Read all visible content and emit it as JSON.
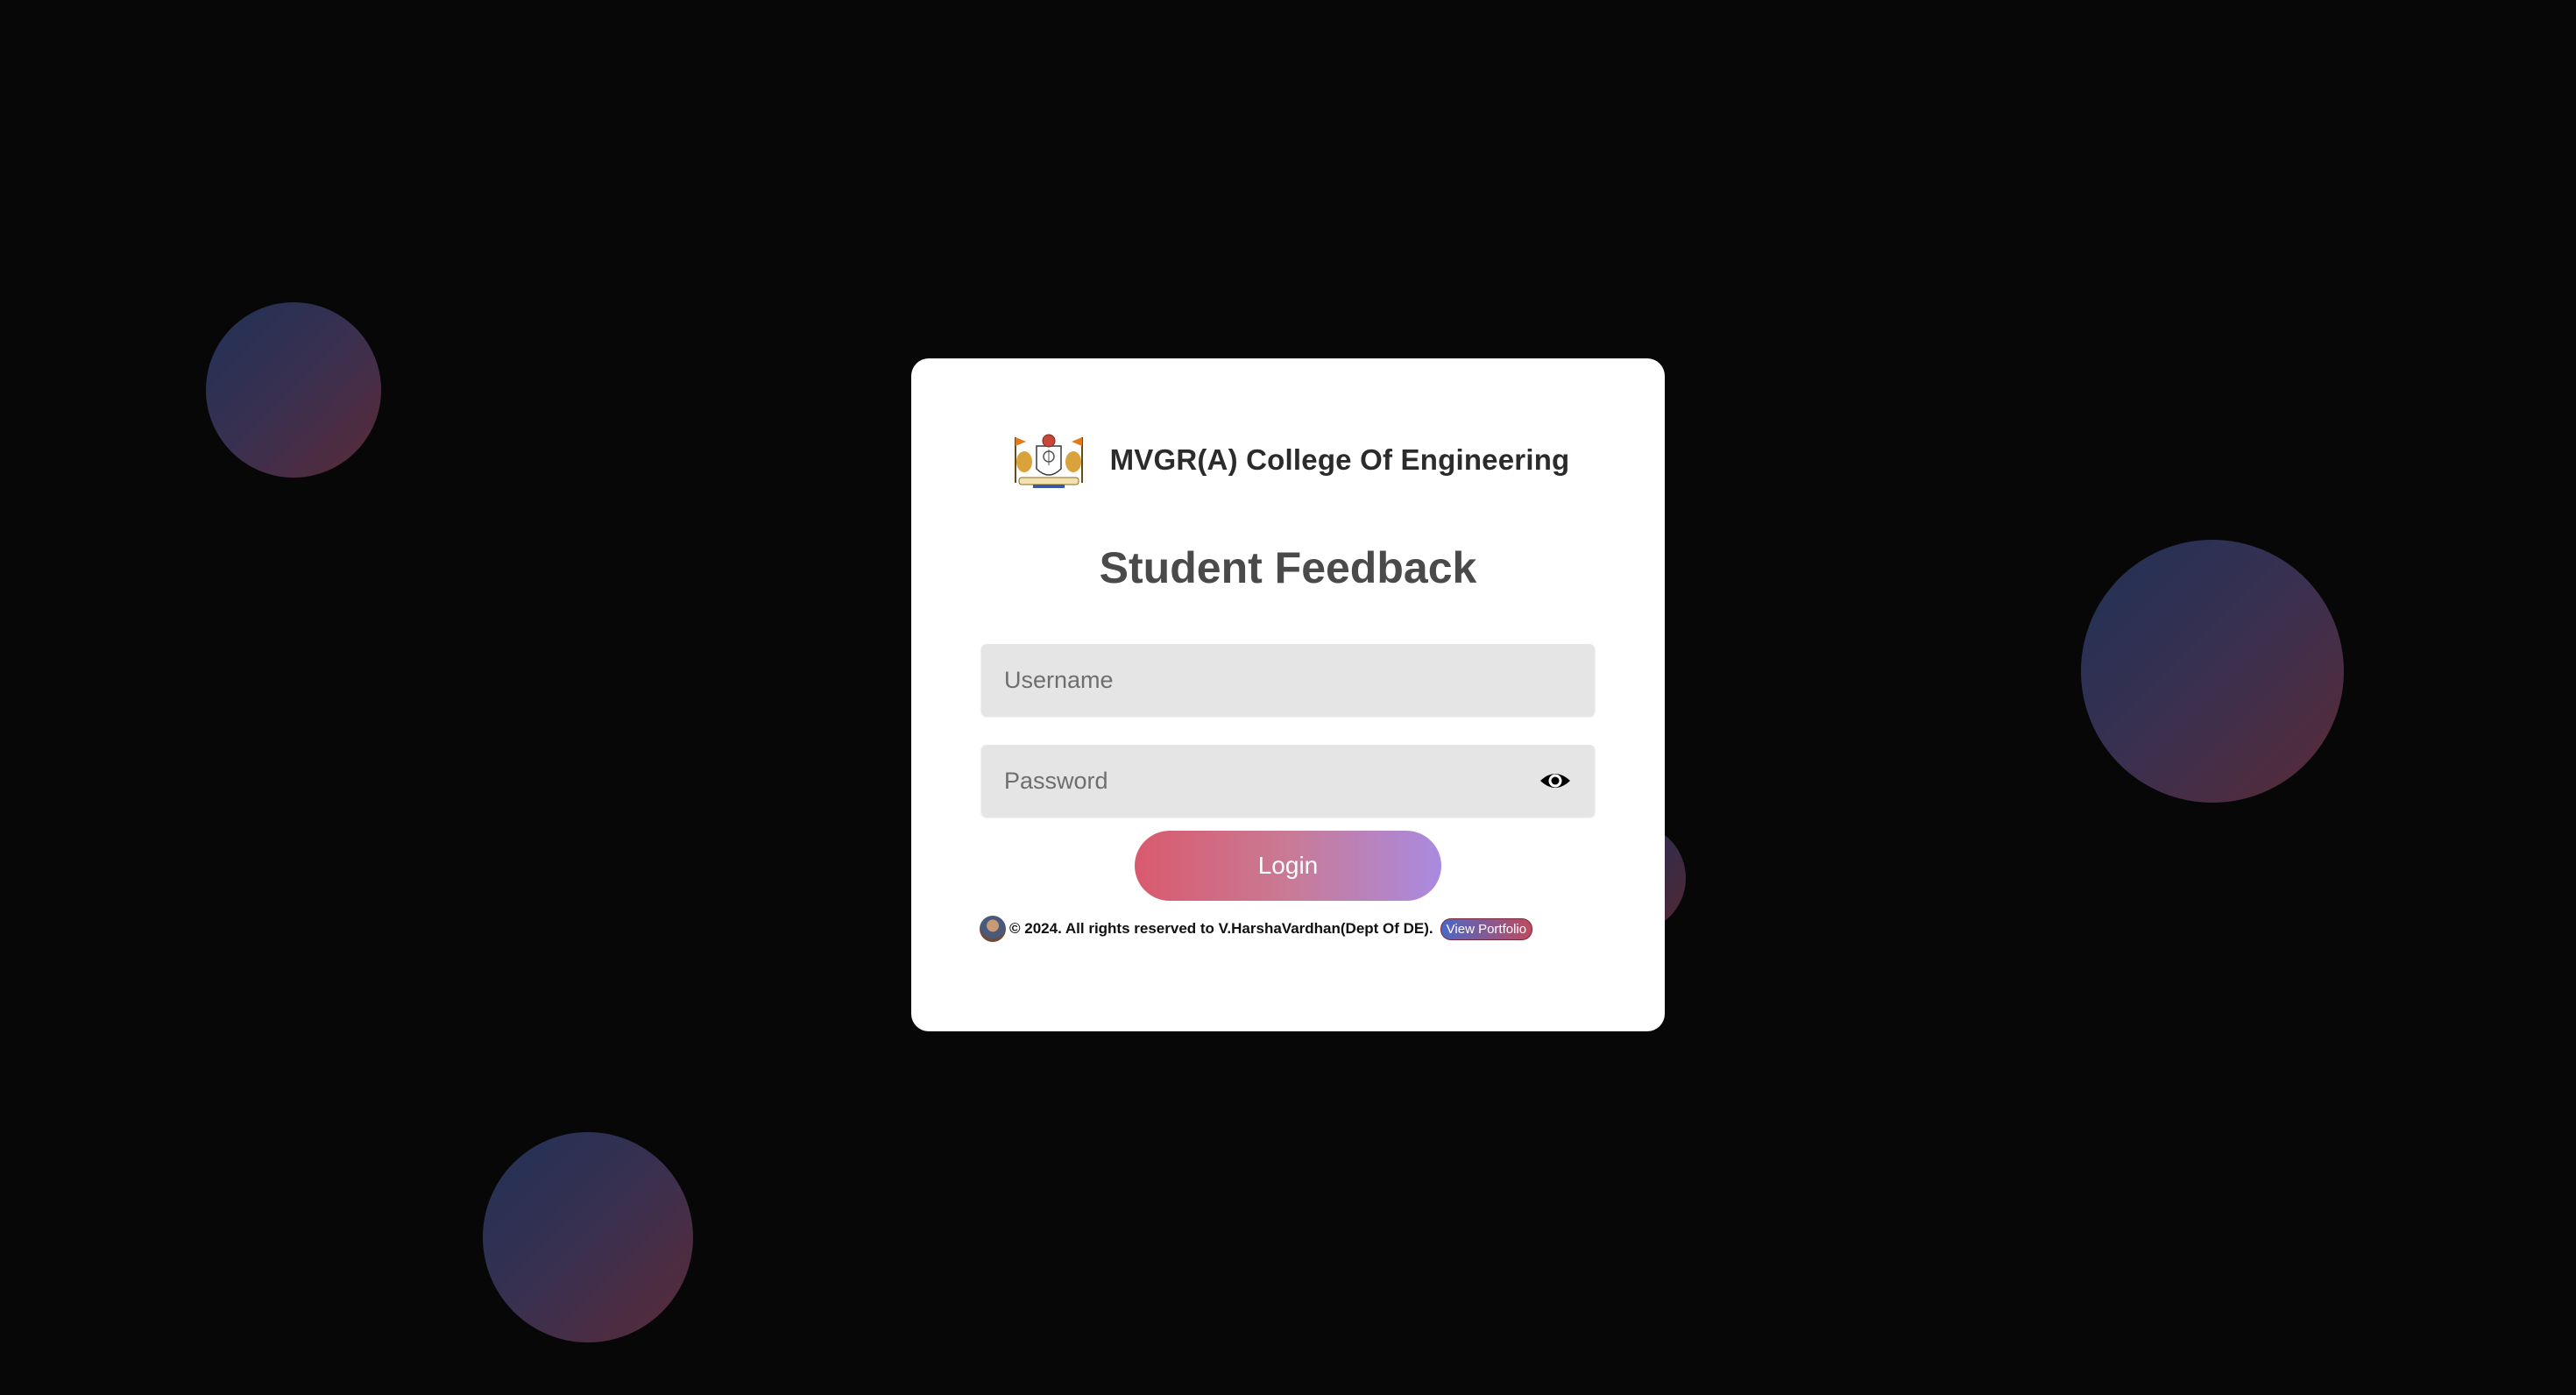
{
  "brand": {
    "college_name": "MVGR(A) College Of Engineering",
    "logo_icon": "college-crest-icon"
  },
  "form": {
    "heading": "Student Feedback",
    "username_placeholder": "Username",
    "username_value": "",
    "password_placeholder": "Password",
    "password_value": "",
    "password_toggle_icon": "eye-icon",
    "login_label": "Login"
  },
  "footer": {
    "copyright": "© 2024. All rights reserved to V.HarshaVardhan(Dept Of DE).",
    "portfolio_label": "View Portfolio"
  },
  "colors": {
    "background": "#070707",
    "card": "#ffffff",
    "input_bg": "#e5e5e5",
    "button_start": "#d95a6e",
    "button_end": "#a98ae0",
    "bubble_start": "#1f3256",
    "bubble_end": "#5a2a36"
  }
}
